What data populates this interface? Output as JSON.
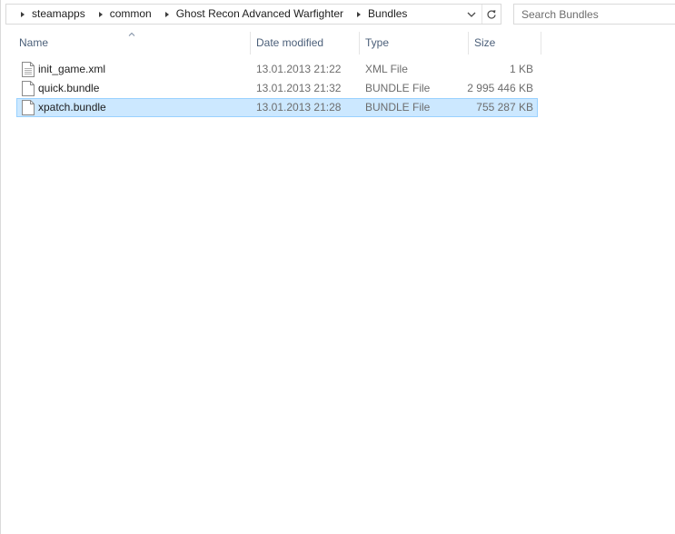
{
  "breadcrumb": {
    "segments": [
      {
        "label": "steamapps"
      },
      {
        "label": "common"
      },
      {
        "label": "Ghost Recon Advanced Warfighter"
      },
      {
        "label": "Bundles"
      }
    ]
  },
  "address_bar": {
    "dropdown_icon": "chevron-down-icon",
    "refresh_icon": "refresh-icon"
  },
  "search": {
    "placeholder": "Search Bundles",
    "value": ""
  },
  "columns": [
    {
      "key": "name",
      "label": "Name",
      "sorted": "ascending"
    },
    {
      "key": "date_modified",
      "label": "Date modified"
    },
    {
      "key": "type",
      "label": "Type"
    },
    {
      "key": "size",
      "label": "Size"
    }
  ],
  "files": [
    {
      "name": "init_game.xml",
      "date_modified": "13.01.2013 21:22",
      "type": "XML File",
      "size": "1 KB",
      "icon": "xml-file-icon",
      "selected": false
    },
    {
      "name": "quick.bundle",
      "date_modified": "13.01.2013 21:32",
      "type": "BUNDLE File",
      "size": "2 995 446 KB",
      "icon": "file-icon",
      "selected": false
    },
    {
      "name": "xpatch.bundle",
      "date_modified": "13.01.2013 21:28",
      "type": "BUNDLE File",
      "size": "755 287 KB",
      "icon": "file-icon",
      "selected": true
    }
  ],
  "colors": {
    "selection_fill": "#cce8ff",
    "selection_border": "#99d1ff",
    "header_text": "#4c607a",
    "secondary_text": "#6d6d6d"
  }
}
